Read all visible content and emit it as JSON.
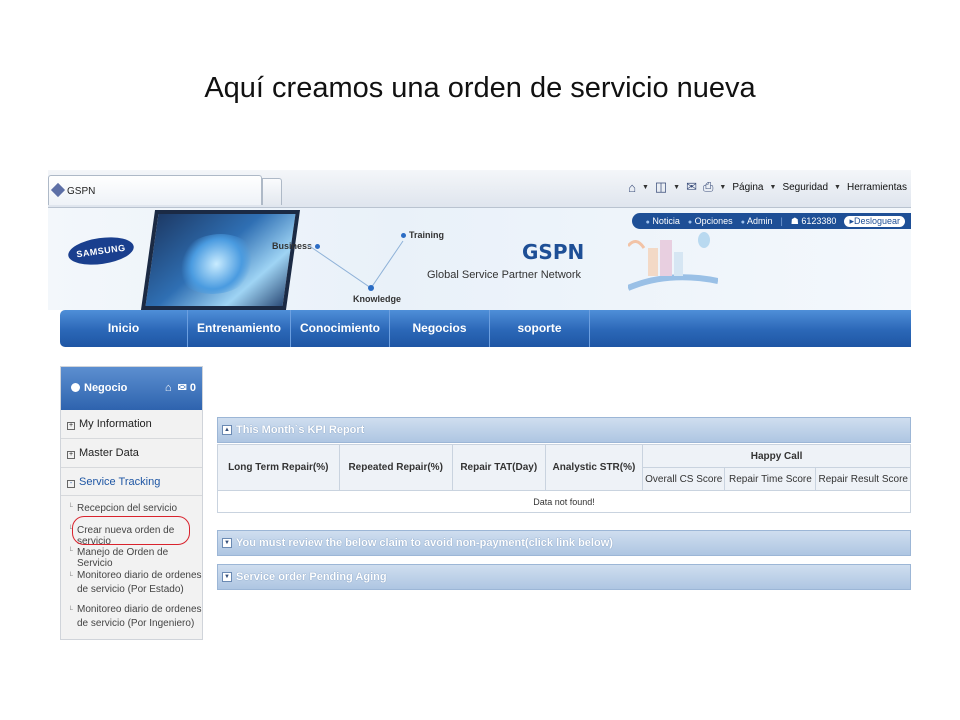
{
  "slide": {
    "title": "Aquí creamos una orden de servicio nueva"
  },
  "browser": {
    "tab_title": "GSPN",
    "toolbar": {
      "page": "Página",
      "security": "Seguridad",
      "tools": "Herramientas"
    }
  },
  "header": {
    "top_links": [
      "Noticia",
      "Opciones",
      "Admin"
    ],
    "user_id": "6123380",
    "logout": "Desloguear",
    "logo": "SAMSUNG",
    "labels": {
      "business": "Business",
      "training": "Training",
      "knowledge": "Knowledge"
    },
    "brand": "GSPN",
    "brand_subtitle": "Global Service Partner Network"
  },
  "main_nav": [
    "Inicio",
    "Entrenamiento",
    "Conocimiento",
    "Negocios",
    "soporte"
  ],
  "sidebar": {
    "title": "Negocio",
    "mail_count": "0",
    "sections": [
      {
        "label": "My Information",
        "toggle": "+"
      },
      {
        "label": "Master Data",
        "toggle": "+"
      },
      {
        "label": "Service Tracking",
        "toggle": "-"
      }
    ],
    "items": [
      "Recepcion del servicio",
      "Crear nueva orden de servicio",
      "Manejo de Orden de Servicio",
      "Monitoreo diario de ordenes de servicio (Por Estado)",
      "Monitoreo diario de ordenes de servicio (Por Ingeniero)"
    ]
  },
  "kpi": {
    "panel_title": "This Month`s KPI Report",
    "columns": [
      "Long Term Repair(%)",
      "Repeated Repair(%)",
      "Repair TAT(Day)",
      "Analystic STR(%)"
    ],
    "group_header": "Happy Call",
    "sub_columns": [
      "Overall CS Score",
      "Repair Time Score",
      "Repair Result Score"
    ],
    "empty_message": "Data not found!"
  },
  "panels": {
    "claim_review": "You must review the below claim to avoid non-payment(click link below)",
    "pending_aging": "Service order Pending Aging"
  },
  "colors": {
    "nav_blue": "#2b67b7",
    "highlight_red": "#d9232d",
    "panel_blue": "#aec6e2"
  }
}
